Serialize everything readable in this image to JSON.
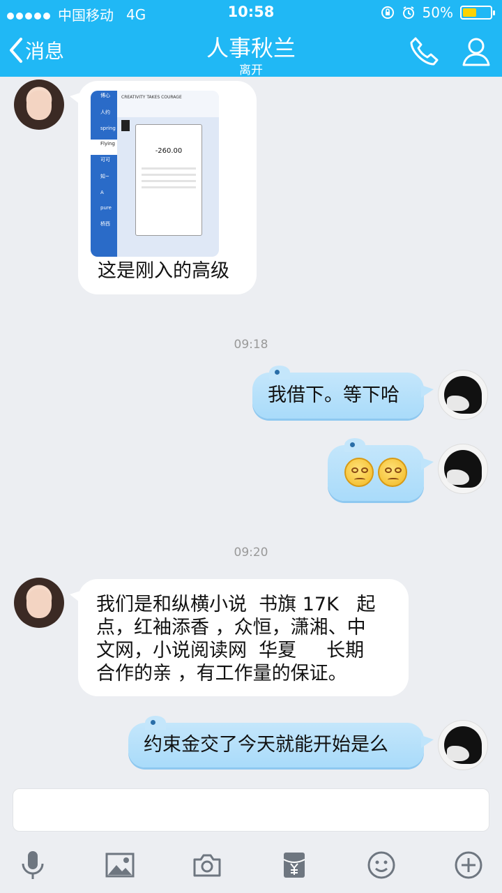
{
  "status": {
    "signal_dots": 5,
    "carrier": "中国移动",
    "network": "4G",
    "time": "10:58",
    "battery": "50%",
    "battery_level": 0.5
  },
  "nav": {
    "back_label": "消息",
    "title": "人事秋兰",
    "subtitle": "离开"
  },
  "messages": {
    "m1_caption": "这是刚入的高级",
    "m1_image": {
      "sidebar_names": [
        "博心",
        "人约",
        "spring",
        "Flying",
        "可可",
        "知~",
        "A",
        "pure",
        "桥西"
      ],
      "header_text": "CREATIVITY TAKES COURAGE",
      "amount": "-260.00"
    },
    "ts1": "09:18",
    "m2": "我借下。等下哈",
    "ts2": "09:20",
    "m4_lines": [
      "我们是和纵横小说  书旗 17K   起",
      "点，红袖添香 ，众恒，潇湘、中",
      "文网，小说阅读网  华夏     长期",
      "合作的亲 ，有工作量的保证。"
    ],
    "m5": "约束金交了今天就能开始是么"
  },
  "colors": {
    "nav": "#20b8f5",
    "bubble_out": "#b9e1fa",
    "background": "#eceef2"
  },
  "icons": [
    "back-chevron-icon",
    "phone-icon",
    "profile-icon",
    "microphone-icon",
    "image-icon",
    "camera-icon",
    "red-packet-icon",
    "emoji-icon",
    "plus-icon"
  ]
}
